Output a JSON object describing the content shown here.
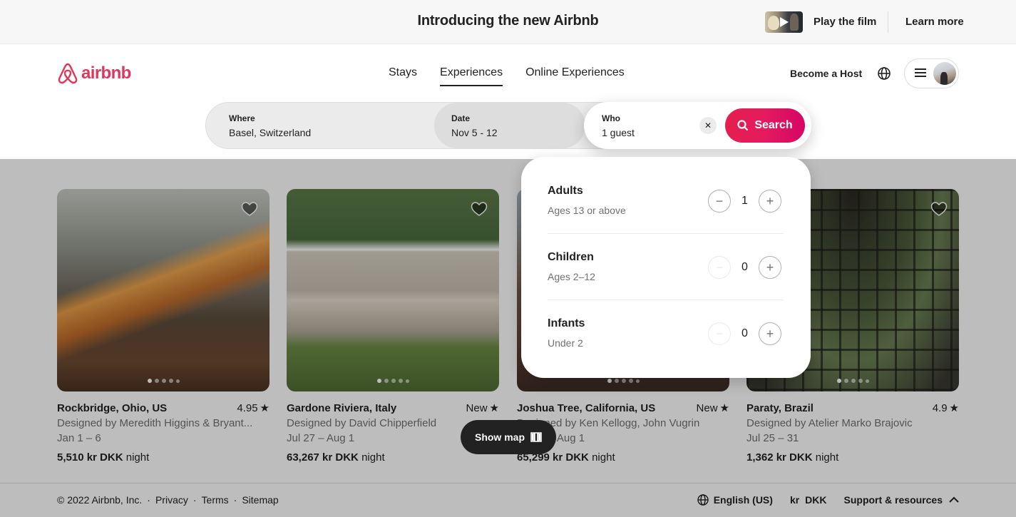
{
  "announcement": {
    "title": "Introducing the new Airbnb",
    "play_film": "Play the film",
    "learn_more": "Learn more"
  },
  "brand": {
    "name": "airbnb",
    "color": "#e1365b"
  },
  "nav": {
    "tabs": [
      {
        "label": "Stays",
        "active": false
      },
      {
        "label": "Experiences",
        "active": true
      },
      {
        "label": "Online Experiences",
        "active": false
      }
    ],
    "become_host": "Become a Host"
  },
  "search": {
    "where_label": "Where",
    "where_value": "Basel, Switzerland",
    "date_label": "Date",
    "date_value": "Nov 5 - 12",
    "who_label": "Who",
    "who_value": "1 guest",
    "button_label": "Search",
    "button_color": "#e31c5f"
  },
  "guests": [
    {
      "title": "Adults",
      "subtitle": "Ages 13 or above",
      "count": "1",
      "minus_enabled": true
    },
    {
      "title": "Children",
      "subtitle": "Ages 2–12",
      "count": "0",
      "minus_enabled": false
    },
    {
      "title": "Infants",
      "subtitle": "Under 2",
      "count": "0",
      "minus_enabled": false
    }
  ],
  "listings": [
    {
      "location": "Rockbridge, Ohio, US",
      "rating": "4.95",
      "designer": "Designed by Meredith Higgins & Bryant...",
      "dates": "Jan 1 – 6",
      "price": "5,510 kr DKK",
      "price_unit": "night"
    },
    {
      "location": "Gardone Riviera, Italy",
      "rating": "New",
      "designer": "Designed by David Chipperfield",
      "dates": "Jul 27 – Aug 1",
      "price": "63,267 kr DKK",
      "price_unit": "night"
    },
    {
      "location": "Joshua Tree, California, US",
      "rating": "New",
      "designer": "Designed by Ken Kellogg, John Vugrin",
      "dates": "Jul 27 – Aug 1",
      "price": "65,299 kr DKK",
      "price_unit": "night"
    },
    {
      "location": "Paraty, Brazil",
      "rating": "4.9",
      "designer": "Designed by Atelier Marko Brajovic",
      "dates": "Jul 25 – 31",
      "price": "1,362 kr DKK",
      "price_unit": "night"
    }
  ],
  "show_map": "Show map",
  "footer": {
    "copyright": "© 2022 Airbnb, Inc.",
    "links": [
      "Privacy",
      "Terms",
      "Sitemap"
    ],
    "separator": "·",
    "language": "English (US)",
    "currency_symbol": "kr",
    "currency_code": "DKK",
    "support": "Support & resources"
  }
}
